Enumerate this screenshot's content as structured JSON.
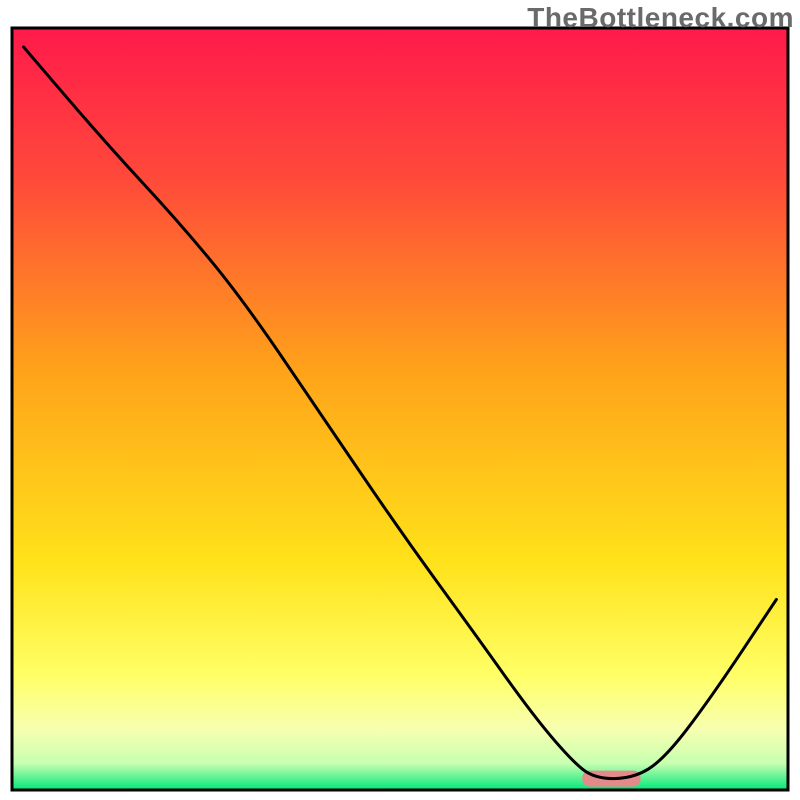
{
  "watermark": "TheBottleneck.com",
  "chart_data": {
    "type": "line",
    "title": "",
    "xlabel": "",
    "ylabel": "",
    "x_range": [
      0,
      100
    ],
    "y_range": [
      0,
      100
    ],
    "gradient_stops": [
      {
        "offset": 0.0,
        "color": "#ff1a4b"
      },
      {
        "offset": 0.2,
        "color": "#ff4a3a"
      },
      {
        "offset": 0.45,
        "color": "#ffa31a"
      },
      {
        "offset": 0.7,
        "color": "#ffe21a"
      },
      {
        "offset": 0.85,
        "color": "#ffff66"
      },
      {
        "offset": 0.92,
        "color": "#f7ffb0"
      },
      {
        "offset": 0.965,
        "color": "#c8ffb0"
      },
      {
        "offset": 1.0,
        "color": "#00e77a"
      }
    ],
    "series": [
      {
        "name": "curve",
        "points": [
          {
            "x": 1.5,
            "y": 97.5
          },
          {
            "x": 12.0,
            "y": 85.0
          },
          {
            "x": 22.0,
            "y": 74.0
          },
          {
            "x": 30.0,
            "y": 64.0
          },
          {
            "x": 40.0,
            "y": 49.0
          },
          {
            "x": 50.0,
            "y": 34.0
          },
          {
            "x": 60.0,
            "y": 20.0
          },
          {
            "x": 67.0,
            "y": 10.0
          },
          {
            "x": 72.0,
            "y": 4.0
          },
          {
            "x": 75.0,
            "y": 1.5
          },
          {
            "x": 80.0,
            "y": 1.5
          },
          {
            "x": 84.0,
            "y": 4.0
          },
          {
            "x": 90.0,
            "y": 12.0
          },
          {
            "x": 98.5,
            "y": 25.0
          }
        ]
      }
    ],
    "marker": {
      "name": "highlight-bar",
      "x_start": 73.5,
      "x_end": 81.0,
      "y": 1.5,
      "color": "#e58a8a"
    },
    "border": {
      "color": "#000000",
      "width": 3
    }
  }
}
